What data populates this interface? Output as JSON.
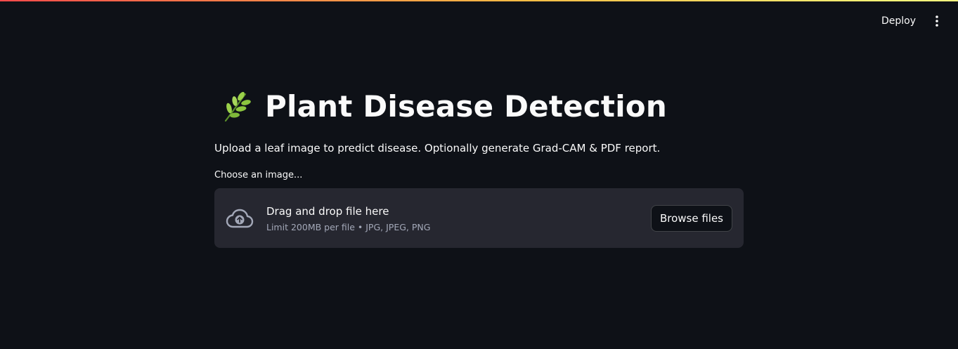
{
  "header": {
    "deploy_label": "Deploy",
    "menu_icon": "more-vert-icon"
  },
  "main": {
    "title": "Plant Disease Detection",
    "title_icon": "herb-icon",
    "subtitle": "Upload a leaf image to predict disease. Optionally generate Grad-CAM & PDF report.",
    "uploader": {
      "label": "Choose an image...",
      "instruction": "Drag and drop file here",
      "limit_text": "Limit 200MB per file • JPG, JPEG, PNG",
      "browse_label": "Browse files",
      "icon": "cloud-upload-icon"
    }
  },
  "colors": {
    "background": "#0e1117",
    "dropzone": "#262730",
    "text": "#fafafa",
    "muted_text": "#a3a8b8",
    "decoration_start": "#ff4b4b",
    "decoration_end": "#fffd80"
  }
}
